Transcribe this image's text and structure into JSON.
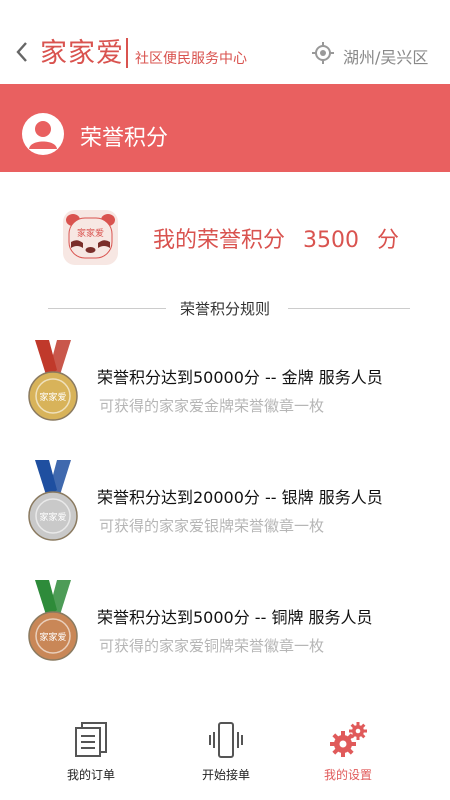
{
  "header": {
    "logo_text": "家家爱",
    "subtitle": "社区便民服务中心",
    "location": "湖州/吴兴区"
  },
  "banner": {
    "title": "荣誉积分"
  },
  "points": {
    "label": "我的荣誉积分",
    "value": "3500",
    "unit": "分"
  },
  "rules": {
    "title": "荣誉积分规则",
    "items": [
      {
        "title": "荣誉积分达到50000分  --  金牌 服务人员",
        "desc": "可获得的家家爱金牌荣誉徽章一枚",
        "ribbon": "#c0392b",
        "medal": "#d8b35a"
      },
      {
        "title": "荣誉积分达到20000分  --  银牌 服务人员",
        "desc": "可获得的家家爱银牌荣誉徽章一枚",
        "ribbon": "#1f4fa0",
        "medal": "#c9c9c9"
      },
      {
        "title": "荣誉积分达到5000分  --  铜牌 服务人员",
        "desc": "可获得的家家爱铜牌荣誉徽章一枚",
        "ribbon": "#2e8b3a",
        "medal": "#c98757"
      }
    ]
  },
  "tabs": [
    {
      "label": "我的订单",
      "icon": "document-icon"
    },
    {
      "label": "开始接单",
      "icon": "vibrate-phone-icon"
    },
    {
      "label": "我的设置",
      "icon": "gears-icon",
      "active": true
    }
  ],
  "colors": {
    "accent": "#e96060",
    "brand": "#d9534f"
  }
}
